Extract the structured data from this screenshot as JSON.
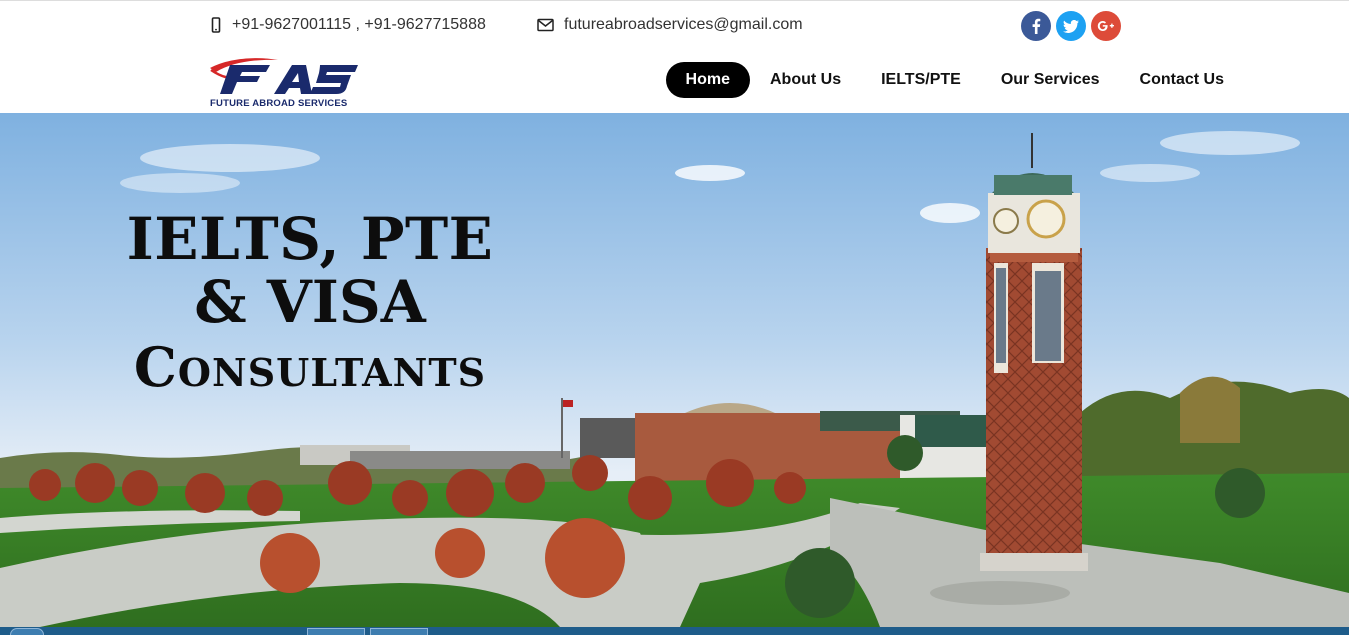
{
  "topbar": {
    "phone": "+91-9627001115 , +91-9627715888",
    "email": "futureabroadservices@gmail.com",
    "phone_icon": "mobile-phone-icon",
    "email_icon": "envelope-icon",
    "social": [
      {
        "name": "facebook-icon",
        "glyph": "f",
        "color": "#3b5998"
      },
      {
        "name": "twitter-icon",
        "glyph": "t",
        "color": "#1da1f2"
      },
      {
        "name": "google-plus-icon",
        "glyph": "G+",
        "color": "#dd4b39"
      }
    ]
  },
  "logo": {
    "mark": "FAS",
    "subtitle": "FUTURE ABROAD SERVICES"
  },
  "nav": {
    "items": [
      {
        "label": "Home",
        "active": true
      },
      {
        "label": "About Us",
        "active": false
      },
      {
        "label": "IELTS/PTE",
        "active": false
      },
      {
        "label": "Our Services",
        "active": false
      },
      {
        "label": "Contact Us",
        "active": false
      }
    ]
  },
  "hero": {
    "line1": "IELTS, PTE",
    "line2": "& VISA",
    "line3": "Consultants"
  },
  "colors": {
    "nav_active_bg": "#000000",
    "logo_blue": "#1a2a6c",
    "logo_red": "#d62828"
  }
}
